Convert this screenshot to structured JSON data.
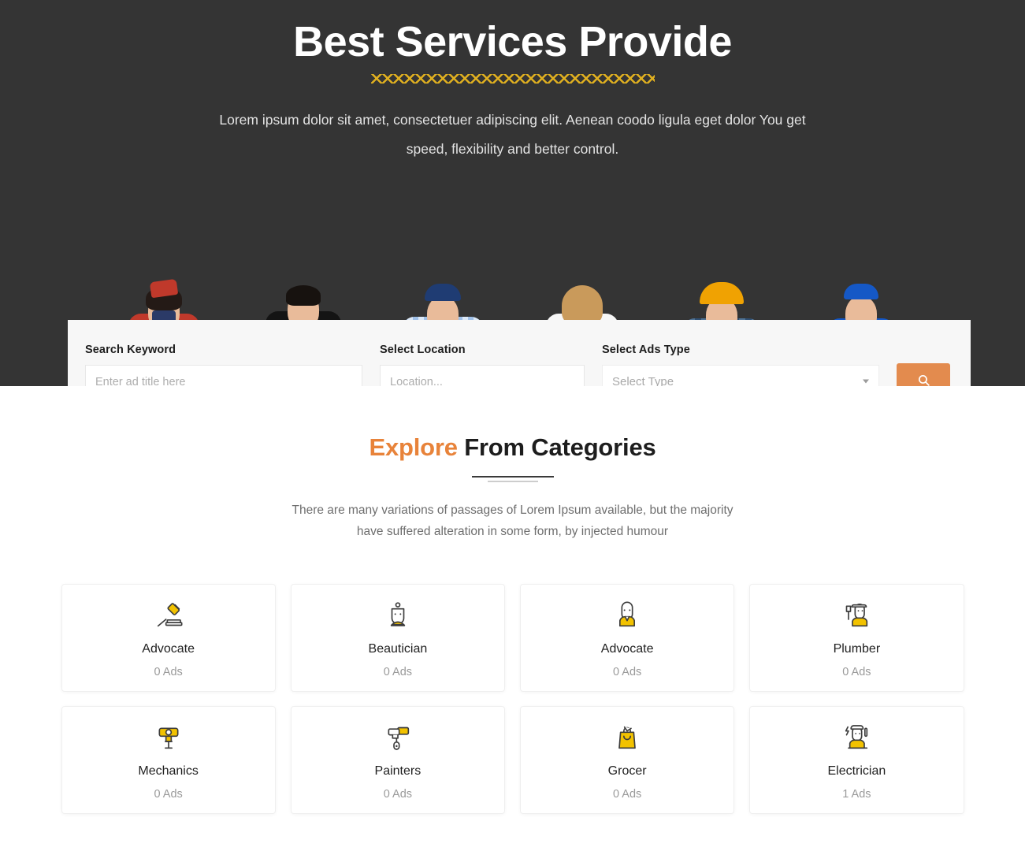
{
  "hero": {
    "title": "Best Services Provide",
    "subtitle": "Lorem ipsum dolor sit amet, consectetuer adipiscing elit. Aenean coodo ligula eget dolor You get speed, flexibility and better control.",
    "background_color": "#343434",
    "divider_color": "#e0b020",
    "people": [
      {
        "name": "flight-attendant"
      },
      {
        "name": "businessman"
      },
      {
        "name": "plumber"
      },
      {
        "name": "doctor"
      },
      {
        "name": "construction-worker"
      },
      {
        "name": "tire-mechanic"
      }
    ]
  },
  "search": {
    "keyword_label": "Search Keyword",
    "keyword_placeholder": "Enter ad title here",
    "keyword_value": "",
    "location_label": "Select Location",
    "location_placeholder": "Location...",
    "location_value": "",
    "type_label": "Select Ads Type",
    "type_selected": "Select Type",
    "search_icon": "search-icon",
    "button_color": "#e38b4e"
  },
  "categories_section": {
    "title_accent": "Explore",
    "title_rest": " From Categories",
    "accent_color": "#e8833a",
    "description": "There are many variations of passages of Lorem Ipsum available, but the majority have suffered alteration in some form, by injected humour",
    "items": [
      {
        "name": "Advocate",
        "count": "0 Ads",
        "icon": "gavel-icon"
      },
      {
        "name": "Beautician",
        "count": "0 Ads",
        "icon": "beautician-icon"
      },
      {
        "name": "Advocate",
        "count": "0 Ads",
        "icon": "businessman-icon"
      },
      {
        "name": "Plumber",
        "count": "0 Ads",
        "icon": "plumber-icon"
      },
      {
        "name": "Mechanics",
        "count": "0 Ads",
        "icon": "valve-icon"
      },
      {
        "name": "Painters",
        "count": "0 Ads",
        "icon": "paint-roller-icon"
      },
      {
        "name": "Grocer",
        "count": "0 Ads",
        "icon": "grocery-bag-icon"
      },
      {
        "name": "Electrician",
        "count": "1 Ads",
        "icon": "electrician-icon"
      }
    ]
  }
}
